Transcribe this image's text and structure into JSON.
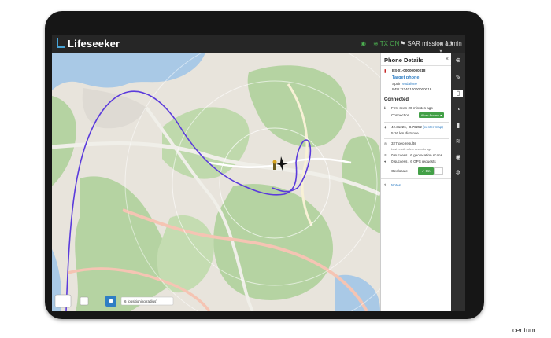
{
  "app": {
    "name": "Lifeseeker"
  },
  "topbar": {
    "signal_label": "TX ON",
    "mission_label": "SAR mission 1",
    "user_label": "admin"
  },
  "panel": {
    "title": "Phone Details",
    "close": "×",
    "device_id": "ES-01-00000000018",
    "device_name": "Target phone",
    "operator_label": "Spain",
    "operator_value": "vodafone",
    "imsi_label": "IMSI:",
    "imsi_value": "214010000000018",
    "section_connected": "Connected",
    "first_seen": "First seen 20 minutes ago",
    "connection_label": "Connection",
    "connection_value": "Allow Access ▾",
    "coords": "42.31226, -8.76252",
    "coords_link": "(center map)",
    "distance": "5.16 km distance",
    "geo_results": "327 geo results",
    "last_result": "Last result: a few seconds ago",
    "geoloc_scans": "0 success / 6 geolocation scans",
    "gps_requests": "0 success / 6 GPS requests",
    "geolocate_label": "Geolocate",
    "geolocate_value": "✓ On",
    "notes": "Notes..."
  },
  "map": {
    "bottom_tooltip": "6 (positioning radius)"
  },
  "caption": "centum",
  "colors": {
    "accent": "#47a3d6",
    "track": "#5b3bdc",
    "green": "#43a047"
  },
  "icons": [
    "globe-icon",
    "edit-icon",
    "phone-icon",
    "chat-icon",
    "signal-icon",
    "wifi-icon",
    "eye-icon",
    "settings-icon"
  ]
}
